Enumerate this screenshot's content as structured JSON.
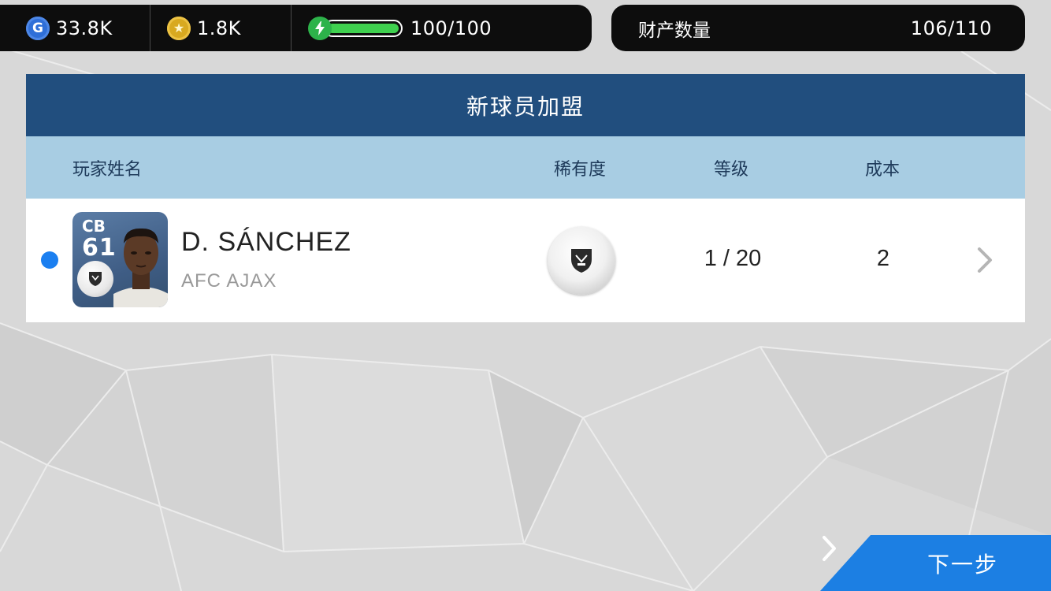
{
  "resources": {
    "gp": {
      "icon": "gp-coin-icon",
      "glyph": "G",
      "value": "33.8K"
    },
    "coins": {
      "icon": "star-coin-icon",
      "glyph": "★",
      "value": "1.8K"
    },
    "energy": {
      "icon": "lightning-icon",
      "value": "100/100",
      "fill_fraction": 1.0
    }
  },
  "assets": {
    "label": "财产数量",
    "value": "106/110"
  },
  "panel": {
    "title": "新球员加盟",
    "columns": {
      "name": "玩家姓名",
      "rarity": "稀有度",
      "level": "等级",
      "cost": "成本"
    },
    "player": {
      "position": "CB",
      "rating": "61",
      "name": "D. SÁNCHEZ",
      "club": "AFC AJAX",
      "rarity_icon": "white-ball-rarity-icon",
      "level": "1 / 20",
      "cost": "2",
      "is_new": true
    }
  },
  "next_button": {
    "label": "下一步"
  },
  "colors": {
    "header_blue": "#214e7e",
    "column_header": "#a8cde3",
    "new_dot": "#1b7ff0",
    "next_button": "#1c7fe3",
    "energy_green": "#3fd04f"
  }
}
